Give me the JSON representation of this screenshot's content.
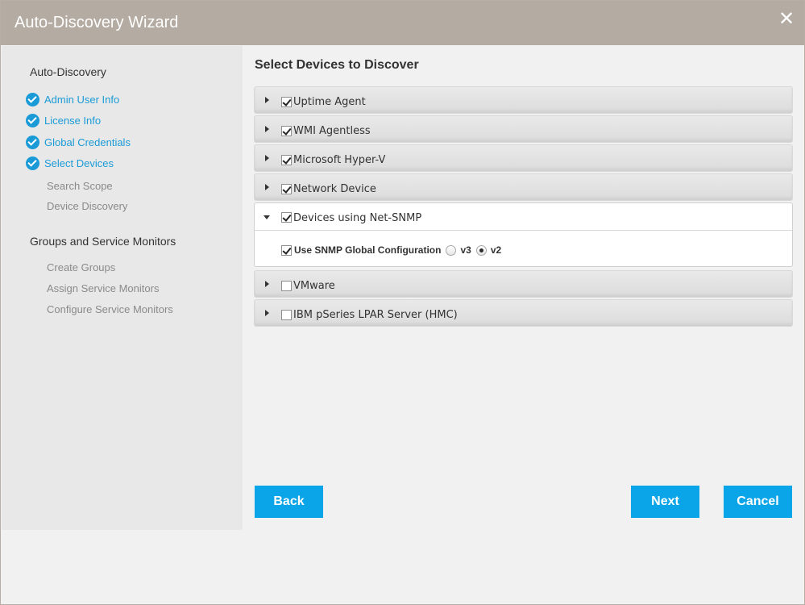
{
  "window": {
    "title": "Auto-Discovery Wizard",
    "close_glyph": "✕"
  },
  "sidebar": {
    "section1_title": "Auto-Discovery",
    "steps": [
      {
        "label": "Admin User Info",
        "done": true
      },
      {
        "label": "License Info",
        "done": true
      },
      {
        "label": "Global Credentials",
        "done": true
      },
      {
        "label": "Select Devices",
        "done": true
      }
    ],
    "substeps1": [
      "Search Scope",
      "Device Discovery"
    ],
    "section2_title": "Groups and Service Monitors",
    "substeps2": [
      "Create Groups",
      "Assign Service Monitors",
      "Configure Service Monitors"
    ]
  },
  "main": {
    "title": "Select Devices to Discover",
    "devices": [
      {
        "label": "Uptime Agent",
        "checked": true
      },
      {
        "label": "WMI Agentless",
        "checked": true
      },
      {
        "label": "Microsoft Hyper-V",
        "checked": true
      },
      {
        "label": "Network Device",
        "checked": true
      }
    ],
    "expanded": {
      "label": "Devices using Net-SNMP",
      "checked": true,
      "option_label": "Use SNMP Global Configuration",
      "option_checked": true,
      "radio_v3": "v3",
      "radio_v2": "v2",
      "selected_version": "v2"
    },
    "devices_after": [
      {
        "label": "VMware",
        "checked": false
      },
      {
        "label": "IBM pSeries LPAR Server (HMC)",
        "checked": false
      }
    ]
  },
  "buttons": {
    "back": "Back",
    "next": "Next",
    "cancel": "Cancel"
  },
  "colors": {
    "accent": "#0aa5e8",
    "titlebar": "#b4aba2",
    "link": "#1a9bd7"
  }
}
